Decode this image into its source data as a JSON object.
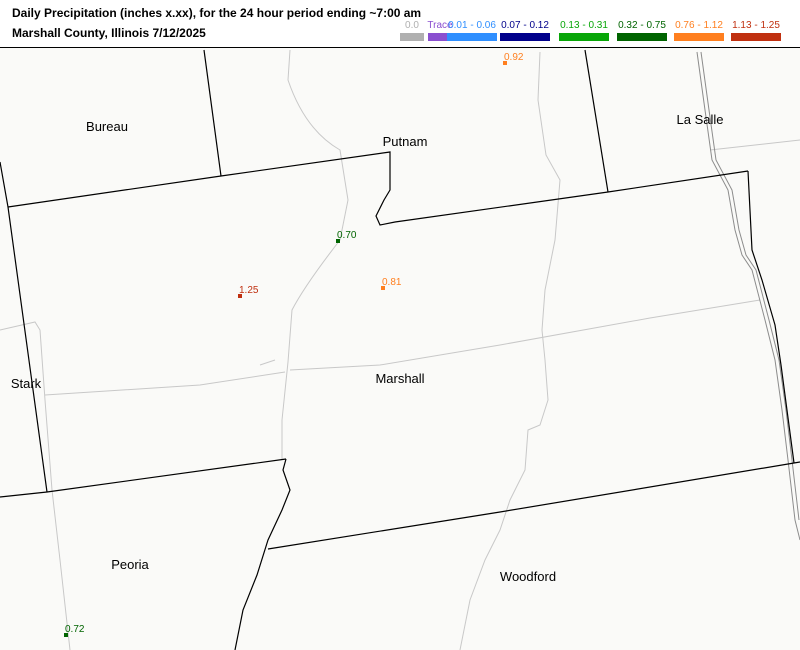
{
  "title": {
    "line1": "Daily Precipitation (inches  x.xx),  for the 24 hour period ending ~7:00 am",
    "line2": "Marshall County, Illinois  7/12/2025"
  },
  "legend": [
    {
      "label": "0.0",
      "color": "#b0b0b0",
      "text_color": "#b0b0b0"
    },
    {
      "label": "Trace",
      "color": "#8a4fd0",
      "text_color": "#8a4fd0"
    },
    {
      "label": "0.01 - 0.06",
      "color": "#2f8fff",
      "text_color": "#2f8fff"
    },
    {
      "label": "0.07 - 0.12",
      "color": "#00008b",
      "text_color": "#00008b"
    },
    {
      "label": "0.13 - 0.31",
      "color": "#08a608",
      "text_color": "#08a608"
    },
    {
      "label": "0.32 - 0.75",
      "color": "#006400",
      "text_color": "#006400"
    },
    {
      "label": "0.76 - 1.12",
      "color": "#ff7f1f",
      "text_color": "#ff7f1f"
    },
    {
      "label": "1.13 - 1.25",
      "color": "#c03010",
      "text_color": "#c03010"
    }
  ],
  "counties": [
    {
      "name": "Bureau"
    },
    {
      "name": "Putnam"
    },
    {
      "name": "La Salle"
    },
    {
      "name": "Stark"
    },
    {
      "name": "Marshall"
    },
    {
      "name": "Peoria"
    },
    {
      "name": "Woodford"
    }
  ],
  "observations": [
    {
      "value": "0.92",
      "color": "#ff7f1f"
    },
    {
      "value": "0.70",
      "color": "#006400"
    },
    {
      "value": "1.25",
      "color": "#c03010"
    },
    {
      "value": "0.81",
      "color": "#ff7f1f"
    },
    {
      "value": "0.72",
      "color": "#006400"
    }
  ]
}
